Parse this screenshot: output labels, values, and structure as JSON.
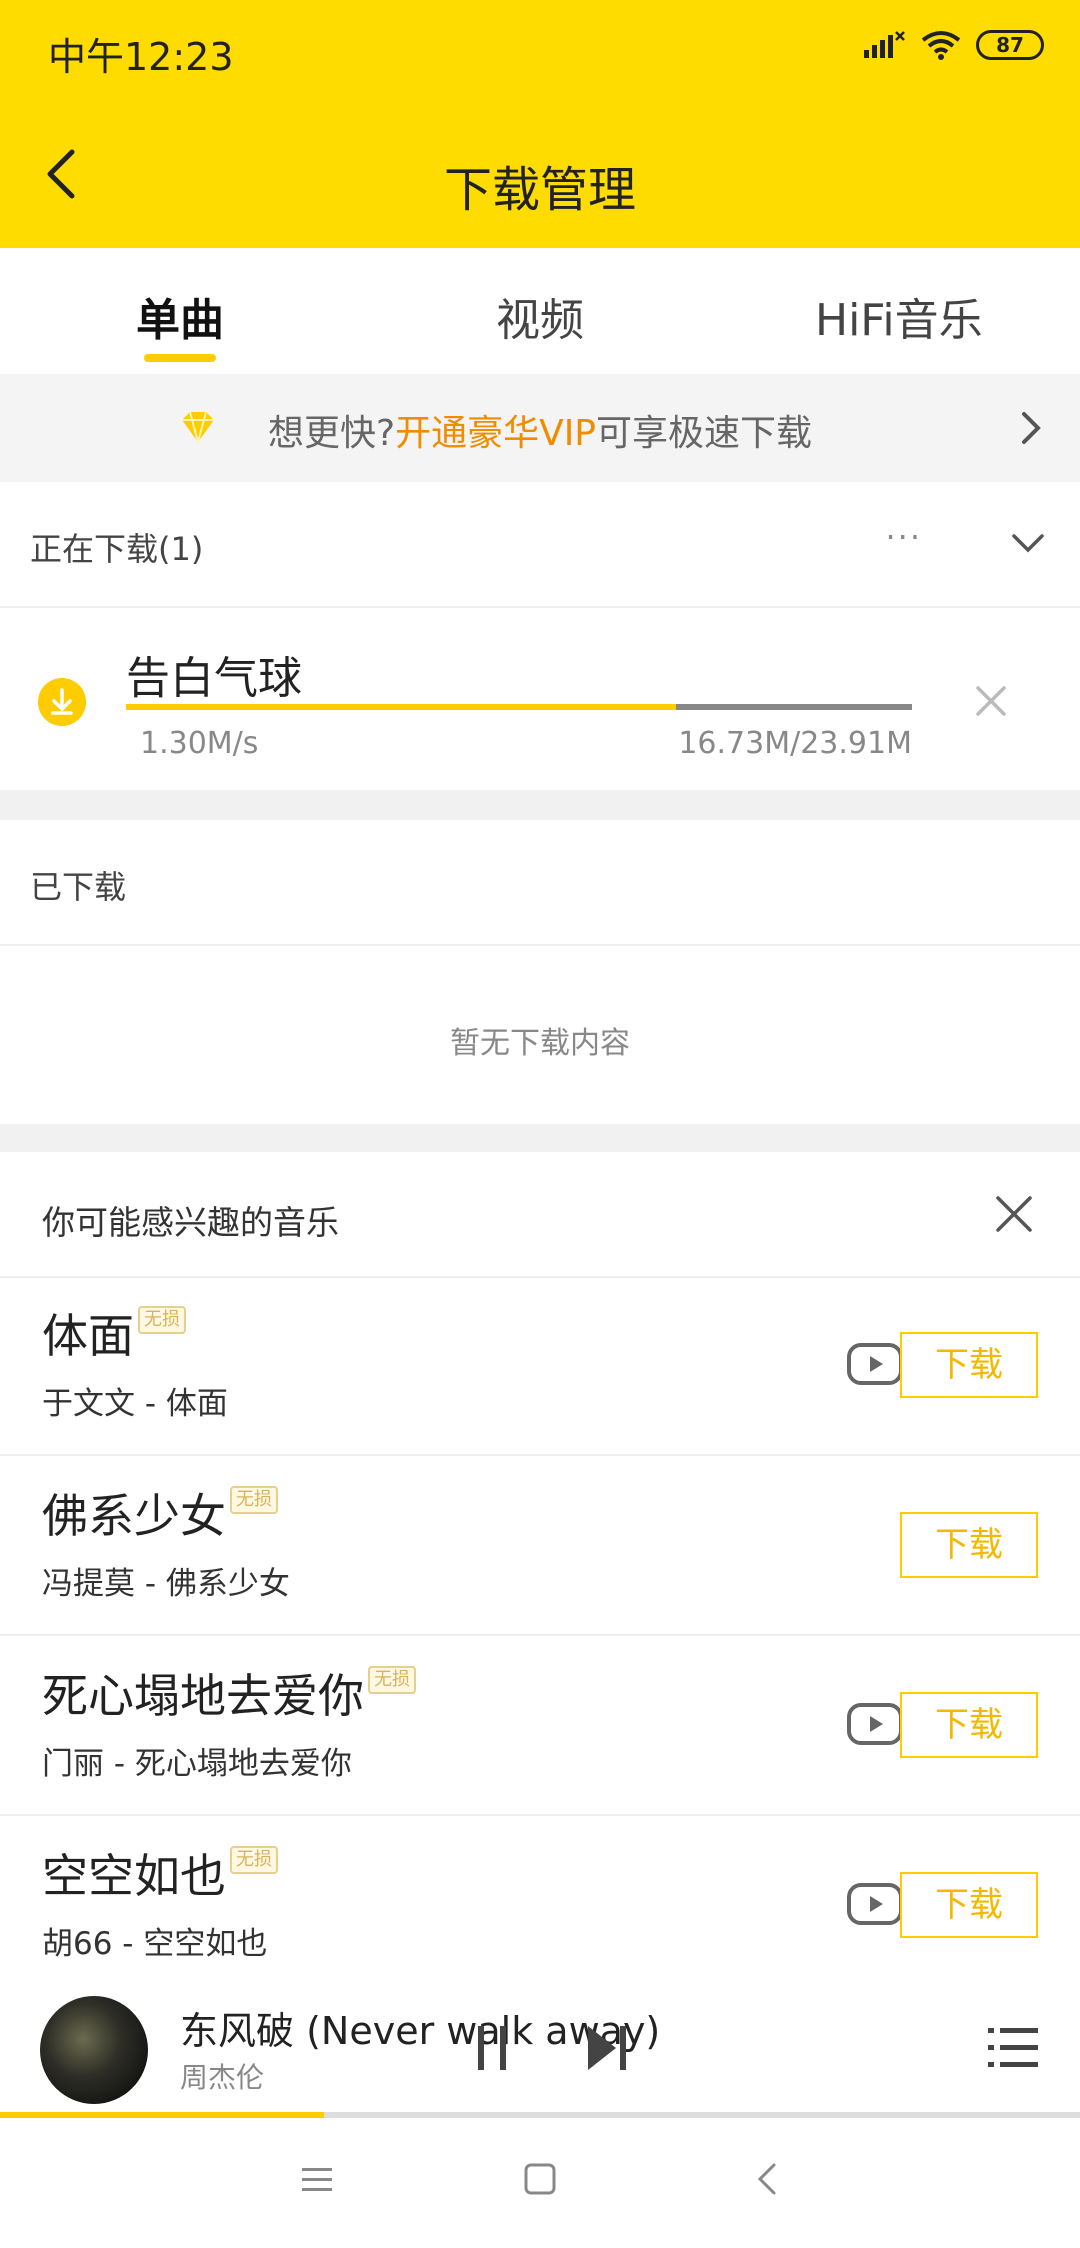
{
  "status_bar": {
    "time": "中午12:23",
    "battery": "87"
  },
  "header": {
    "title": "下载管理"
  },
  "tabs": [
    {
      "label": "单曲",
      "active": true
    },
    {
      "label": "视频",
      "active": false
    },
    {
      "label": "HiFi音乐",
      "active": false
    }
  ],
  "vip_banner": {
    "prefix": "想更快?",
    "highlight": "开通豪华VIP",
    "suffix": "可享极速下载"
  },
  "downloading": {
    "header": "正在下载(1)",
    "more": "···",
    "item": {
      "title": "告白气球",
      "speed": "1.30M/s",
      "size": "16.73M/23.91M",
      "progress": 0.7
    }
  },
  "downloaded": {
    "header": "已下载",
    "empty_text": "暂无下载内容"
  },
  "recommend": {
    "header": "你可能感兴趣的音乐",
    "badge": "无损",
    "download_label": "下载",
    "items": [
      {
        "title": "体面",
        "artist": "于文文 - 体面",
        "has_mv": true
      },
      {
        "title": "佛系少女",
        "artist": "冯提莫 - 佛系少女",
        "has_mv": false
      },
      {
        "title": "死心塌地去爱你",
        "artist": "门丽 - 死心塌地去爱你",
        "has_mv": true
      },
      {
        "title": "空空如也",
        "artist": "胡66 - 空空如也",
        "has_mv": true
      }
    ]
  },
  "player": {
    "song": "东风破 (Never walk away)",
    "artist": "周杰伦",
    "progress": 0.3
  },
  "colors": {
    "brand_yellow": "#ffdc00",
    "accent_orange": "#f08c00"
  }
}
